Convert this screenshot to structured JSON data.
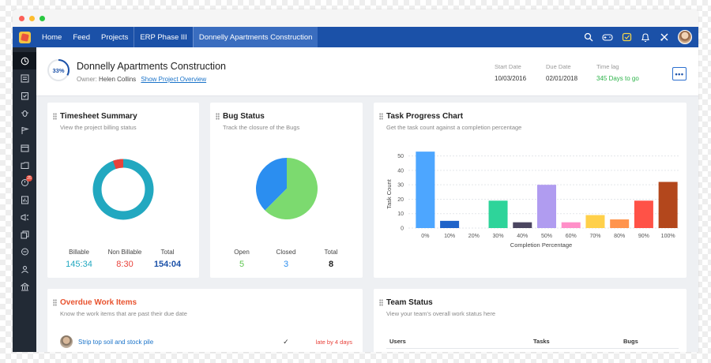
{
  "window": {
    "title": ""
  },
  "nav": {
    "items": [
      "Home",
      "Feed",
      "Projects",
      "ERP Phase III",
      "Donnelly Apartments Construction"
    ],
    "active_index": 4
  },
  "icons": {
    "nav_right": [
      "search-icon",
      "gamepad-icon",
      "chat-icon",
      "bell-icon",
      "settings-icon"
    ],
    "sidebar": [
      "dashboard-icon",
      "list-icon",
      "tasks-icon",
      "bug-icon",
      "milestone-icon",
      "calendar-icon",
      "documents-icon",
      "timesheet-icon",
      "reports-icon",
      "feed-icon",
      "pages-icon",
      "chat-icon",
      "users-icon",
      "bank-icon"
    ]
  },
  "sidebar": {
    "badge": "25"
  },
  "project": {
    "progress": "33%",
    "progress_value": 0.33,
    "title": "Donnelly Apartments Construction",
    "owner_label": "Owner:",
    "owner_name": "Helen Collins",
    "overview_link": "Show Project Overview",
    "start_label": "Start Date",
    "start_value": "10/03/2016",
    "due_label": "Due Date",
    "due_value": "02/01/2018",
    "lag_label": "Time lag",
    "lag_value": "345 Days to go",
    "more_label": "•••"
  },
  "timesheet": {
    "title": "Timesheet Summary",
    "subtitle": "View the project billing status",
    "billable_label": "Billable",
    "billable_value": "145:34",
    "nonbillable_label": "Non Billable",
    "nonbillable_value": "8:30",
    "total_label": "Total",
    "total_value": "154:04",
    "colors": {
      "billable": "#22a8c0",
      "nonbillable": "#e8423b",
      "total": "#1b51a8"
    }
  },
  "bugs": {
    "title": "Bug Status",
    "subtitle": "Track the closure of the Bugs",
    "open_label": "Open",
    "open_value": "5",
    "closed_label": "Closed",
    "closed_value": "3",
    "total_label": "Total",
    "total_value": "8",
    "colors": {
      "open": "#7cda6f",
      "closed": "#2b8ef0"
    }
  },
  "task_chart": {
    "title": "Task Progress Chart",
    "subtitle": "Get the task count against a completion percentage"
  },
  "chart_data": {
    "type": "bar",
    "categories": [
      "0%",
      "10%",
      "20%",
      "30%",
      "40%",
      "50%",
      "60%",
      "70%",
      "80%",
      "90%",
      "100%"
    ],
    "values": [
      53,
      5,
      0,
      19,
      4,
      30,
      4,
      9,
      6,
      19,
      32
    ],
    "colors": [
      "#4da6ff",
      "#1f63c9",
      "#cccccc",
      "#2ed49a",
      "#4b4560",
      "#b09cf0",
      "#ff8fc8",
      "#ffd04a",
      "#ff944d",
      "#ff5247",
      "#b3471c"
    ],
    "xlabel": "Completion Percentage",
    "ylabel": "Task Count",
    "yticks": [
      0,
      10,
      20,
      30,
      40,
      50
    ],
    "ylim": [
      0,
      58
    ],
    "grid": true
  },
  "overdue": {
    "title": "Overdue Work Items",
    "subtitle": "Know the work items that are past their due date",
    "item_label": "Strip top soil and stock pile",
    "item_check": "✓",
    "item_status": "late by 4 days"
  },
  "team": {
    "title": "Team Status",
    "subtitle": "View your team's overall work status here",
    "col_users": "Users",
    "col_tasks": "Tasks",
    "col_bugs": "Bugs"
  }
}
